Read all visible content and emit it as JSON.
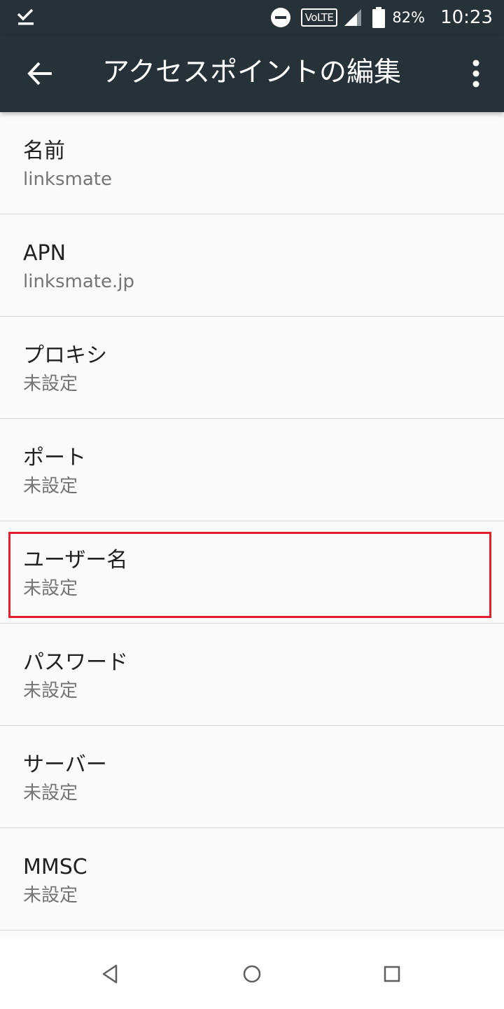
{
  "status_bar": {
    "left_icon": "download-done-icon",
    "volte": "VoLTE",
    "battery_percent": "82%",
    "time": "10:23"
  },
  "app_bar": {
    "title": "アクセスポイントの編集",
    "back_icon": "arrow-back-icon",
    "overflow_icon": "more-vert-icon"
  },
  "fields": [
    {
      "label": "名前",
      "value": "linksmate"
    },
    {
      "label": "APN",
      "value": "linksmate.jp"
    },
    {
      "label": "プロキシ",
      "value": "未設定"
    },
    {
      "label": "ポート",
      "value": "未設定"
    },
    {
      "label": "ユーザー名",
      "value": "未設定"
    },
    {
      "label": "パスワード",
      "value": "未設定"
    },
    {
      "label": "サーバー",
      "value": "未設定"
    },
    {
      "label": "MMSC",
      "value": "未設定"
    }
  ],
  "highlight": {
    "color": "#e0202a",
    "target": "ユーザー名"
  },
  "colors": {
    "app_bar": "#263238",
    "background": "#fafafa",
    "title_text": "#212121",
    "value_text": "#757575"
  }
}
